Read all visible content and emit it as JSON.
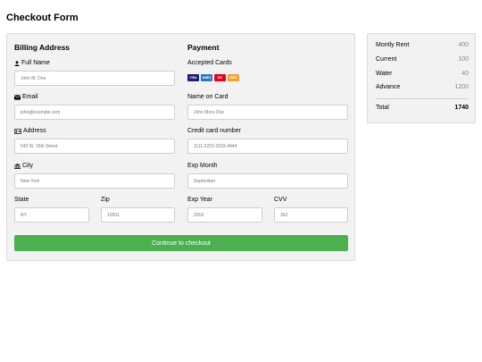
{
  "page": {
    "title": "Checkout Form"
  },
  "billing": {
    "heading": "Billing Address",
    "full_name": {
      "label": "Full Name",
      "placeholder": "John M. Doe"
    },
    "email": {
      "label": "Email",
      "placeholder": "john@example.com"
    },
    "address": {
      "label": "Address",
      "placeholder": "542 W. 15th Street"
    },
    "city": {
      "label": "City",
      "placeholder": "New York"
    },
    "state": {
      "label": "State",
      "placeholder": "NY"
    },
    "zip": {
      "label": "Zip",
      "placeholder": "10001"
    }
  },
  "payment": {
    "heading": "Payment",
    "accepted_cards": {
      "label": "Accepted Cards",
      "cards": [
        {
          "name": "visa-icon",
          "text": "VISA",
          "color": "#1a1f71"
        },
        {
          "name": "amex-icon",
          "text": "AMEX",
          "color": "#2e77bb"
        },
        {
          "name": "mastercard-icon",
          "text": "MC",
          "color": "#eb001b"
        },
        {
          "name": "discover-icon",
          "text": "DISC",
          "color": "#f4a32a"
        }
      ]
    },
    "name_on_card": {
      "label": "Name on Card",
      "placeholder": "John More Doe"
    },
    "card_number": {
      "label": "Credit card number",
      "placeholder": "1111-2222-3333-4444"
    },
    "exp_month": {
      "label": "Exp Month",
      "placeholder": "September"
    },
    "exp_year": {
      "label": "Exp Year",
      "placeholder": "2018"
    },
    "cvv": {
      "label": "CVV",
      "placeholder": "352"
    }
  },
  "checkout_button": {
    "label": "Continue to checkout",
    "color": "#4caf50"
  },
  "summary": {
    "rows": [
      {
        "label": "Montly Rent",
        "value": "400"
      },
      {
        "label": "Current",
        "value": "100"
      },
      {
        "label": "Water",
        "value": "40"
      },
      {
        "label": "Advance",
        "value": "1200"
      }
    ],
    "total": {
      "label": "Total",
      "value": "1740"
    }
  }
}
